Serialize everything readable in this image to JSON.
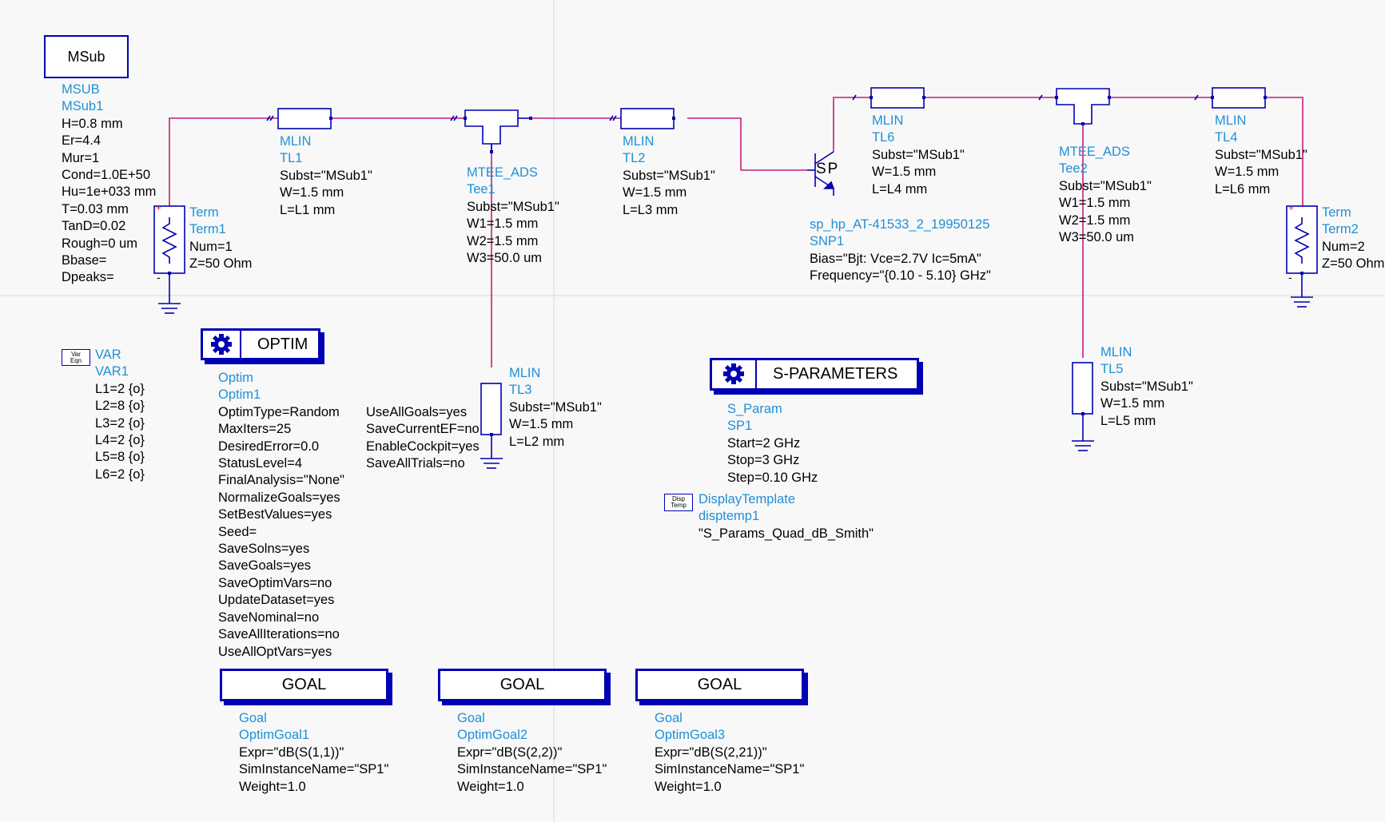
{
  "msub_box": {
    "label": "MSub"
  },
  "msub": {
    "lines": [
      "MSUB",
      "MSub1",
      "H=0.8 mm",
      "Er=4.4",
      "Mur=1",
      "Cond=1.0E+50",
      "Hu=1e+033 mm",
      "T=0.03 mm",
      "TanD=0.02",
      "Rough=0 um",
      "Bbase=",
      "Dpeaks="
    ]
  },
  "term1": {
    "lines": [
      "Term",
      "Term1",
      "Num=1",
      "Z=50 Ohm"
    ]
  },
  "term2": {
    "lines": [
      "Term",
      "Term2",
      "Num=2",
      "Z=50 Ohm"
    ]
  },
  "tl1": {
    "lines": [
      "MLIN",
      "TL1",
      "Subst=\"MSub1\"",
      "W=1.5 mm",
      "L=L1 mm"
    ]
  },
  "tl2": {
    "lines": [
      "MLIN",
      "TL2",
      "Subst=\"MSub1\"",
      "W=1.5 mm",
      "L=L3 mm"
    ]
  },
  "tl3": {
    "lines": [
      "MLIN",
      "TL3",
      "Subst=\"MSub1\"",
      "W=1.5 mm",
      "L=L2 mm"
    ]
  },
  "tl4": {
    "lines": [
      "MLIN",
      "TL4",
      "Subst=\"MSub1\"",
      "W=1.5 mm",
      "L=L6 mm"
    ]
  },
  "tl5": {
    "lines": [
      "MLIN",
      "TL5",
      "Subst=\"MSub1\"",
      "W=1.5 mm",
      "L=L5 mm"
    ]
  },
  "tl6": {
    "lines": [
      "MLIN",
      "TL6",
      "Subst=\"MSub1\"",
      "W=1.5 mm",
      "L=L4 mm"
    ]
  },
  "tee1": {
    "lines": [
      "MTEE_ADS",
      "Tee1",
      "Subst=\"MSub1\"",
      "W1=1.5 mm",
      "W2=1.5 mm",
      "W3=50.0 um"
    ]
  },
  "tee2": {
    "lines": [
      "MTEE_ADS",
      "Tee2",
      "Subst=\"MSub1\"",
      "W1=1.5 mm",
      "W2=1.5 mm",
      "W3=50.0 um"
    ]
  },
  "snp1": {
    "symbol": "SP",
    "lines": [
      "sp_hp_AT-41533_2_19950125",
      "SNP1",
      "Bias=\"Bjt: Vce=2.7V Ic=5mA\"",
      "Frequency=\"{0.10 - 5.10} GHz\""
    ]
  },
  "var": {
    "tag_top": "Var",
    "tag_bottom": "Eqn",
    "lines": [
      "VAR",
      "VAR1",
      "L1=2 {o}",
      "L2=8 {o}",
      "L3=2 {o}",
      "L4=2 {o}",
      "L5=8 {o}",
      "L6=2 {o}"
    ]
  },
  "optim": {
    "button": "OPTIM",
    "lines": [
      "Optim",
      "Optim1",
      "OptimType=Random",
      "MaxIters=25",
      "DesiredError=0.0",
      "StatusLevel=4",
      "FinalAnalysis=\"None\"",
      "NormalizeGoals=yes",
      "SetBestValues=yes",
      "Seed=",
      "SaveSolns=yes",
      "SaveGoals=yes",
      "SaveOptimVars=no",
      "UpdateDataset=yes",
      "SaveNominal=no",
      "SaveAllIterations=no",
      "UseAllOptVars=yes"
    ],
    "lines2": [
      "UseAllGoals=yes",
      "SaveCurrentEF=no",
      "EnableCockpit=yes",
      "SaveAllTrials=no"
    ]
  },
  "sparam": {
    "button": "S-PARAMETERS",
    "lines": [
      "S_Param",
      "SP1",
      "Start=2 GHz",
      "Stop=3 GHz",
      "Step=0.10 GHz"
    ]
  },
  "disp": {
    "tag_top": "Disp",
    "tag_bottom": "Temp",
    "lines": [
      "DisplayTemplate",
      "disptemp1",
      "\"S_Params_Quad_dB_Smith\""
    ]
  },
  "goal1": {
    "button": "GOAL",
    "lines": [
      "Goal",
      "OptimGoal1",
      "Expr=\"dB(S(1,1))\"",
      "SimInstanceName=\"SP1\"",
      "Weight=1.0"
    ]
  },
  "goal2": {
    "button": "GOAL",
    "lines": [
      "Goal",
      "OptimGoal2",
      "Expr=\"dB(S(2,2))\"",
      "SimInstanceName=\"SP1\"",
      "Weight=1.0"
    ]
  },
  "goal3": {
    "button": "GOAL",
    "lines": [
      "Goal",
      "OptimGoal3",
      "Expr=\"dB(S(2,21))\"",
      "SimInstanceName=\"SP1\"",
      "Weight=1.0"
    ]
  },
  "colors": {
    "wire": "#c0207a",
    "component": "#0000b4",
    "name": "#1e90d8",
    "text": "#000000"
  }
}
